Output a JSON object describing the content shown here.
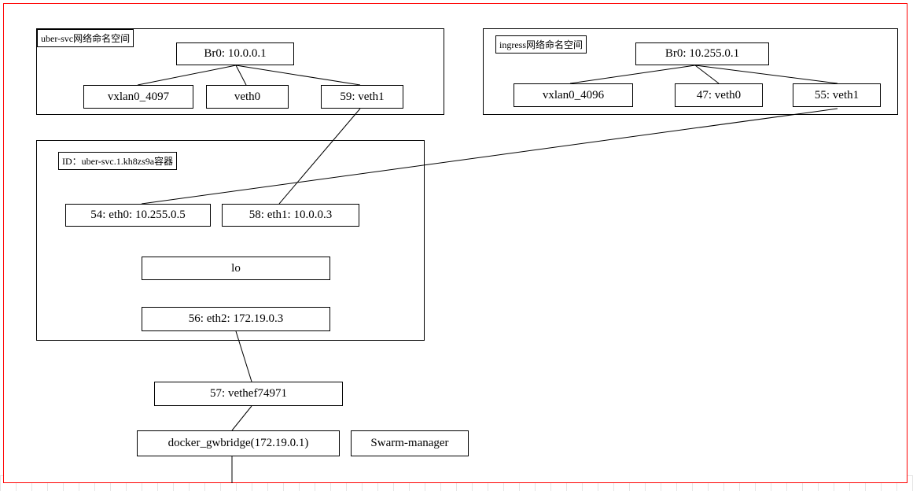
{
  "uberSvcNs": {
    "title": "uber-svc网络命名空间",
    "br0": "Br0: 10.0.0.1",
    "vxlan": "vxlan0_4097",
    "veth0": "veth0",
    "veth1": "59: veth1"
  },
  "ingressNs": {
    "title": "ingress网络命名空间",
    "br0": "Br0: 10.255.0.1",
    "vxlan": "vxlan0_4096",
    "veth0": "47: veth0",
    "veth1": "55: veth1"
  },
  "container": {
    "id": "ID：uber-svc.1.kh8zs9a容器",
    "eth0": "54: eth0: 10.255.0.5",
    "eth1": "58: eth1: 10.0.0.3",
    "lo": "lo",
    "eth2": "56: eth2: 172.19.0.3"
  },
  "vethHost": "57: vethef74971",
  "gwbridge": "docker_gwbridge(172.19.0.1)",
  "swarm": "Swarm-manager"
}
